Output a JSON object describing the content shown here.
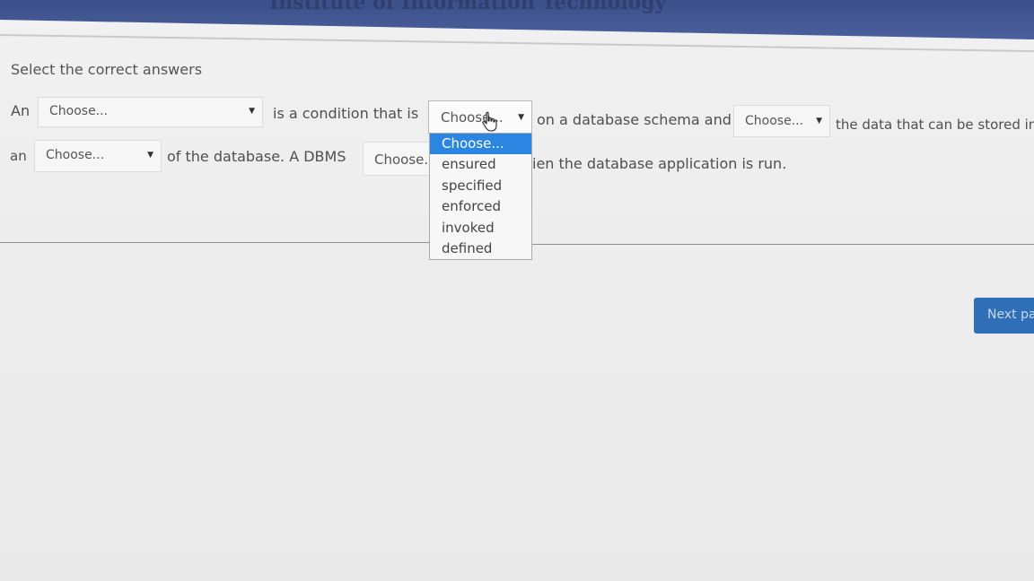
{
  "header": {
    "title": "Institute of Information Technology"
  },
  "question": {
    "instruction": "Select the correct answers",
    "line1": {
      "w1": "An",
      "select1": "Choose...",
      "w2": "is a condition that is",
      "select2": "Choose...",
      "w3": "on a database schema and",
      "select3": "Choose...",
      "w4": "the data that can be stored in"
    },
    "line2": {
      "w1": "an",
      "select1": "Choose...",
      "w2": "of the database. A DBMS",
      "select2": "Choose...",
      "w3": "ien the database application is run."
    },
    "dropdown_options": [
      "Choose...",
      "ensured",
      "specified",
      "enforced",
      "invoked",
      "defined"
    ]
  },
  "navigation": {
    "next_label": "Next pa"
  },
  "icons": {
    "pointer": "hand-pointer-icon",
    "caret": "caret-down-icon"
  },
  "colors": {
    "header": "#3b4f8a",
    "highlight": "#2a86e0",
    "button": "#2f6fb8"
  }
}
